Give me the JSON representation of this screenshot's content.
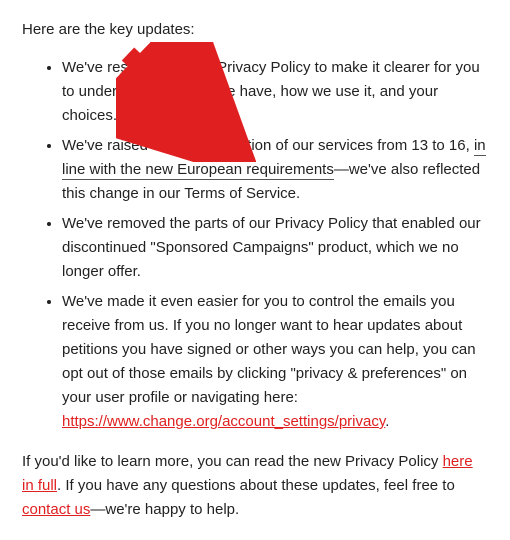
{
  "intro": "Here are the key updates:",
  "bullets": {
    "b0": "We've restructured our Privacy Policy to make it clearer for you to understand the data we have, how we use it, and your choices.",
    "b1": {
      "pre": "We've raised the age restriction of our services from 13 to 16, ",
      "highlight": "in line with the new European requirements",
      "post": "—we've also reflected this change in our Terms of Service."
    },
    "b2": "We've removed the parts of our Privacy Policy that enabled our discontinued \"Sponsored Campaigns\" product, which we no longer offer.",
    "b3": {
      "pre": "We've made it even easier for you to control the emails you receive from us. If you no longer want to hear updates about petitions you have signed or other ways you can help, you can opt out of those emails by clicking \"privacy & preferences\" on your user profile or navigating here: ",
      "link_text": "https://www.change.org/account_settings/privacy",
      "post": "."
    }
  },
  "outro": {
    "p1": "If you'd like to learn more, you can read the new Privacy Policy ",
    "link1": "here in full",
    "p2": ". If you have any questions about these updates, feel free to ",
    "link2": "contact us",
    "p3": "—we're happy to help."
  }
}
